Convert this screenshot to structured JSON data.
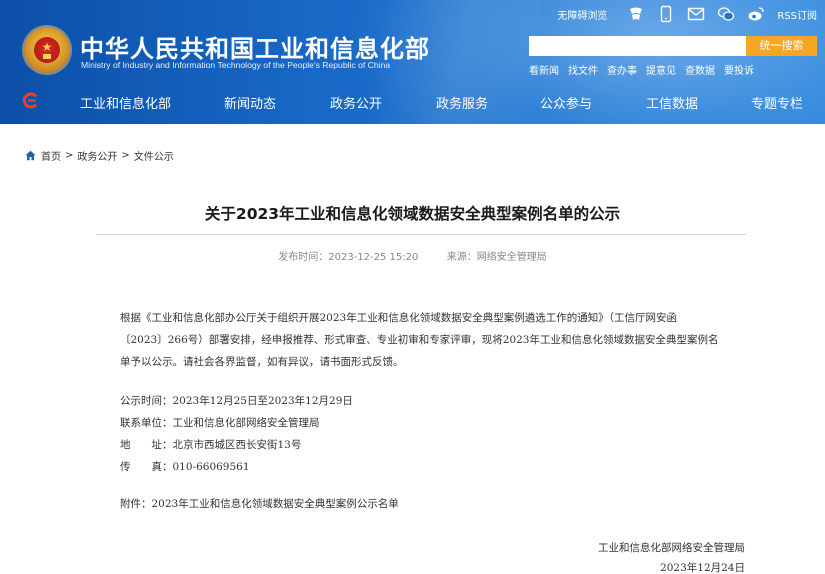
{
  "header": {
    "site_title": "中华人民共和国工业和信息化部",
    "site_subtitle": "Ministry of Industry and Information Technology of the People's Republic of China",
    "accessibility_link": "无障碍浏览",
    "rss_label": "RSS订阅",
    "search": {
      "placeholder": "",
      "button_label": "统一搜索"
    },
    "quick_links": [
      "看新闻",
      "找文件",
      "查办事",
      "提意见",
      "查数据",
      "要投诉"
    ]
  },
  "nav": {
    "items": [
      "工业和信息化部",
      "新闻动态",
      "政务公开",
      "政务服务",
      "公众参与",
      "工信数据",
      "专题专栏"
    ]
  },
  "breadcrumb": {
    "items": [
      "首页",
      "政务公开",
      "文件公示"
    ],
    "separator": ">"
  },
  "article": {
    "title": "关于2023年工业和信息化领域数据安全典型案例名单的公示",
    "publish_time": "发布时间：2023-12-25 15:20",
    "source": "来源：网络安全管理局",
    "paragraph_lines": [
      "根据《工业和信息化部办公厅关于组织开展2023年工业和信息化领域数据安全典型案例遴选工作的通知》（工信厅网安函",
      "〔2023〕266号）部署安排，经申报推荐、形式审查、专业初审和专家评审，现将2023年工业和信息化领域数据安全典型案例名",
      "单予以公示。请社会各界监督，如有异议，请书面形式反馈。"
    ],
    "publicity_period_label": "公示时间：",
    "publicity_period": "2023年12月25日至2023年12月29日",
    "contact_unit_label": "联系单位：",
    "contact_unit": "工业和信息化部网络安全管理局",
    "address_label": "地　　址：",
    "address": "北京市西城区西长安街13号",
    "fax_label": "传　　真：",
    "fax": "010-66069561",
    "attachment": "附件：2023年工业和信息化领域数据安全典型案例公示名单",
    "signature_org": "工业和信息化部网络安全管理局",
    "signature_date": "2023年12月24日"
  },
  "colors": {
    "header_blue": "#1766c4",
    "search_button": "#f5a623",
    "nav_logo_red": "#e8402f"
  }
}
